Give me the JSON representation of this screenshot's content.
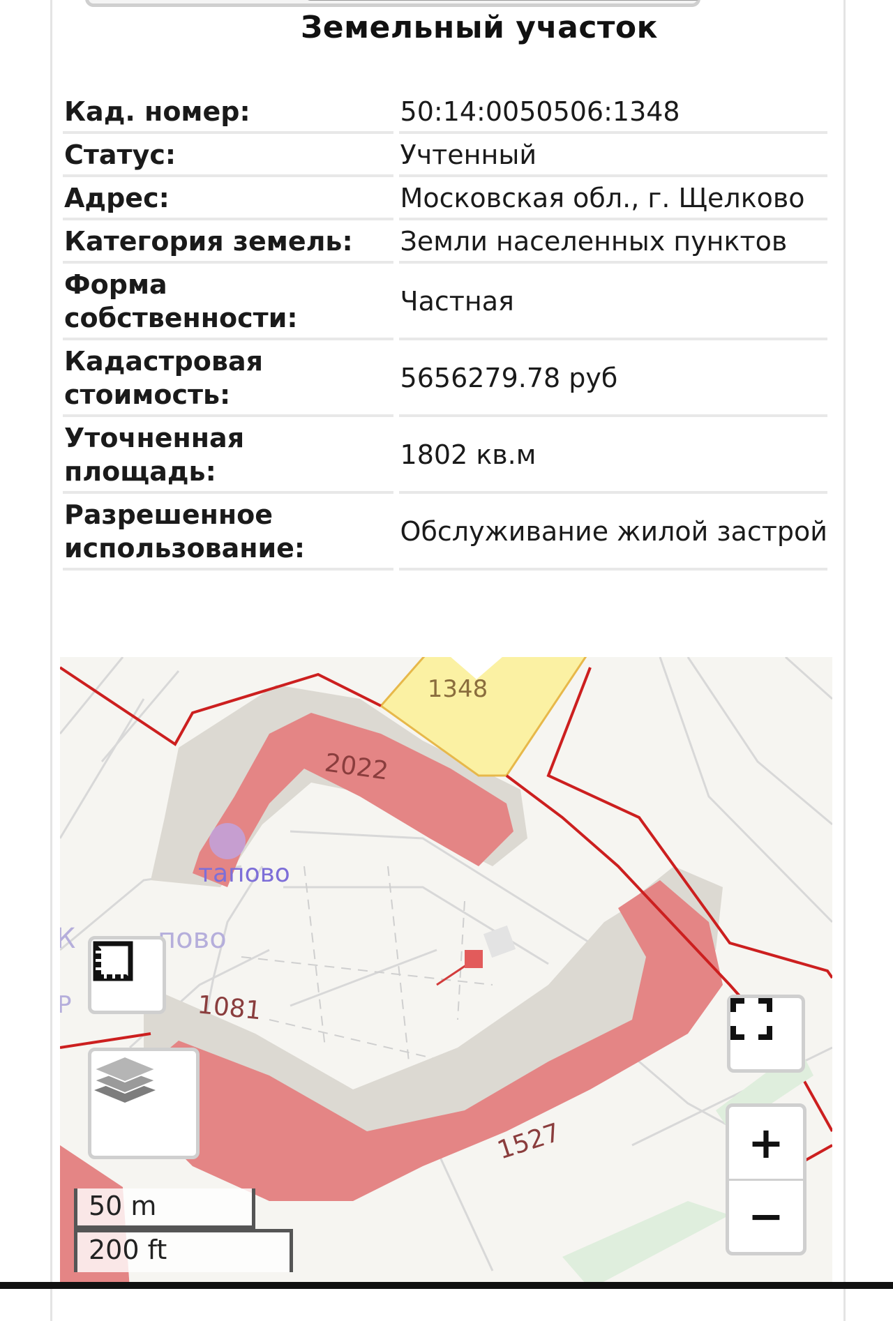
{
  "page": {
    "title": "Земельный участок"
  },
  "properties": [
    {
      "key": "Кад. номер",
      "value": "50:14:0050506:1348"
    },
    {
      "key": "Статус",
      "value": "Учтенный"
    },
    {
      "key": "Адрес",
      "value": "Московская обл., г. Щелково"
    },
    {
      "key": "Категория земель",
      "value": "Земли населенных пунктов"
    },
    {
      "key": "Форма собственности",
      "value": "Частная"
    },
    {
      "key": "Кадастровая стоимость",
      "value": "5656279.78 руб"
    },
    {
      "key": "Уточненная площадь",
      "value": "1802 кв.м"
    },
    {
      "key": "Разрешенное использование",
      "value": "Обслуживание жилой застрой"
    }
  ],
  "map": {
    "parcel_labels": [
      "1348",
      "2022",
      "1081",
      "1527"
    ],
    "place_labels": [
      "тапово",
      "К",
      "пово",
      "Р"
    ],
    "scale": {
      "metric": "50 m",
      "imperial": "200 ft"
    },
    "controls": {
      "ruler_icon": "ruler-icon",
      "layers_icon": "layers-icon",
      "fullscreen_icon": "fullscreen-icon",
      "zoom_in": "+",
      "zoom_out": "−"
    },
    "colors": {
      "building": "#e48585",
      "selected_parcel": "#fbf1a3",
      "parcel_border": "#cc1f1f"
    }
  }
}
